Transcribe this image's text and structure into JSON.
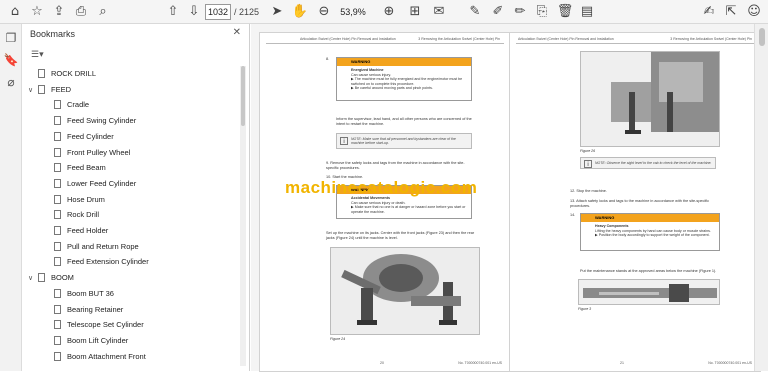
{
  "toolbar": {
    "current_page": "1032",
    "page_total": "/ 2125",
    "zoom": "53,9%"
  },
  "bookmarks": {
    "title": "Bookmarks",
    "items": [
      {
        "label": "ROCK DRILL",
        "level": 1,
        "toggle": ""
      },
      {
        "label": "FEED",
        "level": 1,
        "toggle": "∨"
      },
      {
        "label": "Cradle",
        "level": 2,
        "toggle": ""
      },
      {
        "label": "Feed Swing Cylinder",
        "level": 2,
        "toggle": ""
      },
      {
        "label": "Feed Cylinder",
        "level": 2,
        "toggle": ""
      },
      {
        "label": "Front Pulley Wheel",
        "level": 2,
        "toggle": ""
      },
      {
        "label": "Feed Beam",
        "level": 2,
        "toggle": ""
      },
      {
        "label": "Lower Feed Cylinder",
        "level": 2,
        "toggle": ""
      },
      {
        "label": "Hose Drum",
        "level": 2,
        "toggle": ""
      },
      {
        "label": "Rock Drill",
        "level": 2,
        "toggle": ""
      },
      {
        "label": "Feed Holder",
        "level": 2,
        "toggle": ""
      },
      {
        "label": "Pull and Return Rope",
        "level": 2,
        "toggle": ""
      },
      {
        "label": "Feed Extension Cylinder",
        "level": 2,
        "toggle": ""
      },
      {
        "label": "BOOM",
        "level": 1,
        "toggle": "∨"
      },
      {
        "label": "Boom BUT 36",
        "level": 2,
        "toggle": ""
      },
      {
        "label": "Bearing Retainer",
        "level": 2,
        "toggle": ""
      },
      {
        "label": "Telescope Set Cylinder",
        "level": 2,
        "toggle": ""
      },
      {
        "label": "Boom Lift Cylinder",
        "level": 2,
        "toggle": ""
      },
      {
        "label": "Boom Attachment Front",
        "level": 2,
        "toggle": ""
      }
    ]
  },
  "left_page": {
    "header_left": "Articulation Swivel (Center Hole) Pin Removal and Installation",
    "header_right": "3 Removing the Articulation Swivel (Center Hole) Pin",
    "step8": "8.",
    "warn1_title": "WARNING",
    "warn1_lines": [
      "Energized Machine",
      "Can cause serious injury.",
      "▶ The machine must be fully energized and the engine/motor must be switched on to complete this procedure.",
      "▶ Be careful around moving parts and pinch points."
    ],
    "para1": "Inform the supervisor, lead hand, and all other persons who are concerned of the intent to restart the machine.",
    "note1": "NOTE: Make sure that all personnel and bystanders are clear of the machine before start-up.",
    "step9": "9.   Remove the safety locks and tags from the machine in accordance with the site-specific procedures.",
    "step10": "10. Start the machine.",
    "warn2_title": "WARNING",
    "warn2_lines": [
      "Accidental Movements",
      "Can cause serious injury or death.",
      "▶ Make sure that no one is at danger or hazard zone before you start or operate the machine."
    ],
    "para2": "Set up the machine on its jacks. Center with the front jacks (Figure 23) and then the rear jacks (Figure 24) until the machine is level.",
    "fig_caption": "Figure 24",
    "footer_page": "20",
    "footer_doc": "No. T000000740.001 en-US"
  },
  "right_page": {
    "header_left": "Articulation Swivel (Center Hole) Pin Removal and Installation",
    "header_right": "3 Removing the Articulation Swivel (Center Hole) Pin",
    "fig1_caption": "Figure 26",
    "note1": "NOTE: Observe the sight level to the cab to check the level of the machine.",
    "step12": "12. Stop the machine.",
    "step13": "13. Attach safety locks and tags to the machine in accordance with the site-specific procedures.",
    "step14": "14.",
    "warn_title": "WARNING",
    "warn_lines": [
      "Heavy Components",
      "Lifting the heavy components by hand can cause body or muscle strains.",
      "▶ Position the body accordingly to support the weight of the component."
    ],
    "para": "Put the maintenance stands at the approved areas below the machine (Figure 1).",
    "fig2_caption": "Figure 3",
    "footer_page": "21",
    "footer_doc": "No. T000000740.001 en-US"
  },
  "watermark": "machinecatalogic.com"
}
